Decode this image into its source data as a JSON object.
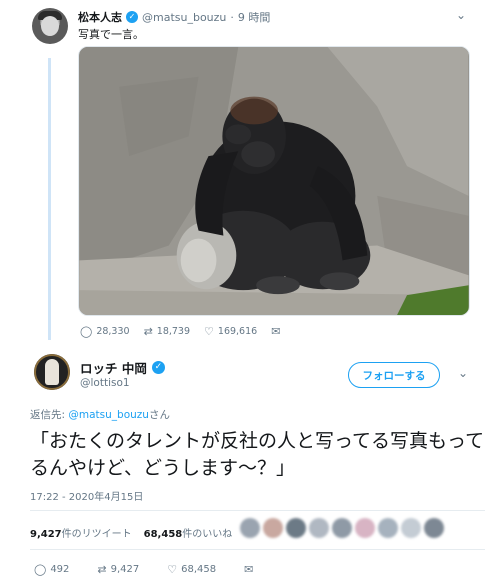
{
  "parent_tweet": {
    "name": "松本人志",
    "handle": "@matsu_bouzu",
    "separator": "·",
    "time": "9 時間",
    "text": "写真で一言。",
    "image_icon": "gorilla-photo",
    "actions": {
      "replies": "28,330",
      "retweets": "18,739",
      "likes": "169,616"
    }
  },
  "tweet": {
    "name": "ロッチ 中岡",
    "handle": "@lottiso1",
    "follow_label": "フォローする",
    "reply_prefix": "返信先:",
    "reply_handle": "@matsu_bouzu",
    "reply_suffix": "さん",
    "text": "「おたくのタレントが反社の人と写ってる写真もってるんやけど、どうします～？」",
    "timestamp": "17:22 - 2020年4月15日",
    "stats": {
      "retweets_count": "9,427",
      "retweets_label": "件のリツイート",
      "likes_count": "68,458",
      "likes_label": "件のいいね"
    },
    "actions": {
      "replies": "492",
      "retweets": "9,427",
      "likes": "68,458"
    }
  },
  "colors": {
    "accent": "#1da1f2",
    "thread_line": "#cfe4f7",
    "secondary_text": "#657786"
  },
  "icons": [
    "verified-icon",
    "chevron-down-icon",
    "reply-icon",
    "retweet-icon",
    "like-icon",
    "dm-icon"
  ]
}
